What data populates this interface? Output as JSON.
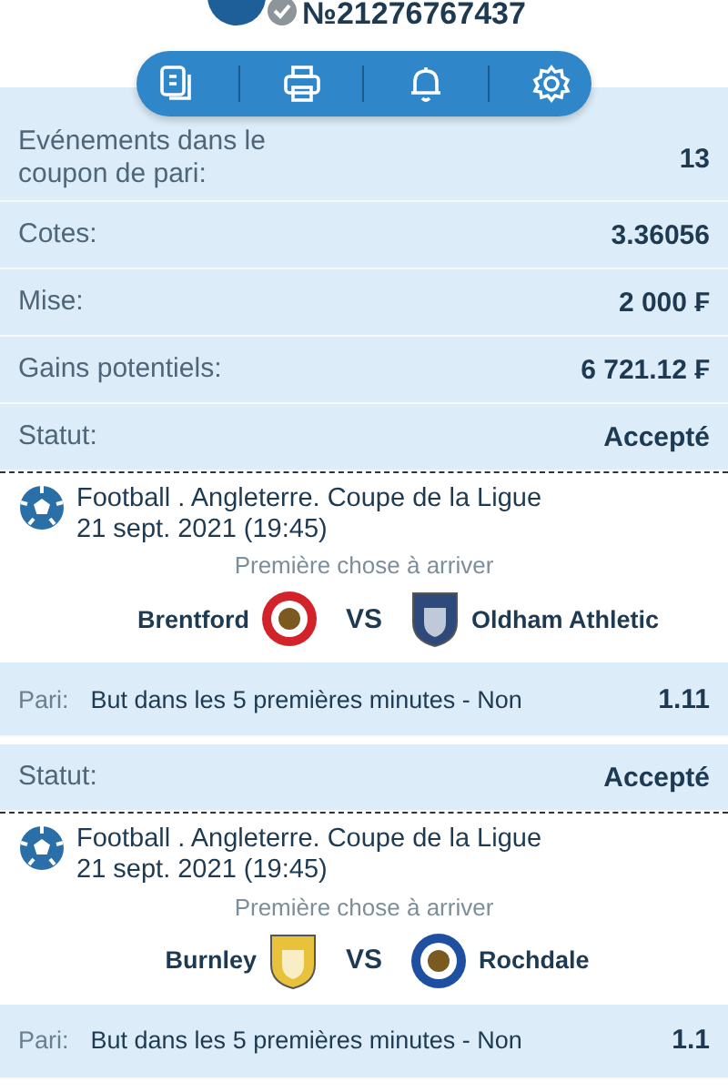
{
  "header": {
    "title": "№21276767437"
  },
  "summary": [
    {
      "label": "Evénements dans le coupon de pari:",
      "value": "13"
    },
    {
      "label": "Cotes:",
      "value": "3.36056"
    },
    {
      "label": "Mise:",
      "value": "2 000 ₣"
    },
    {
      "label": "Gains potentiels:",
      "value": "6 721.12 ₣"
    },
    {
      "label": "Statut:",
      "value": "Accepté"
    }
  ],
  "events": [
    {
      "league": "Football . Angleterre. Coupe de la Ligue",
      "date": "21 sept. 2021 (19:45)",
      "market": "Première chose à arriver",
      "home": {
        "name": "Brentford",
        "crest": {
          "kind": "round",
          "color": "#d2232a"
        }
      },
      "vs": "VS",
      "away": {
        "name": "Oldham Athletic",
        "crest": {
          "kind": "shield",
          "color": "#2e4a7a"
        }
      },
      "bet_label": "Pari:",
      "bet": "But dans les 5 premières minutes - Non",
      "odds": "1.11"
    },
    {
      "status": {
        "label": "Statut:",
        "value": "Accepté"
      },
      "league": "Football . Angleterre. Coupe de la Ligue",
      "date": "21 sept. 2021 (19:45)",
      "market": "Première chose à arriver",
      "home": {
        "name": "Burnley",
        "crest": {
          "kind": "shield",
          "color": "#e8c23a"
        }
      },
      "vs": "VS",
      "away": {
        "name": "Rochdale",
        "crest": {
          "kind": "round",
          "color": "#1f4fa0"
        }
      },
      "bet_label": "Pari:",
      "bet": "But dans les 5 premières minutes - Non",
      "odds": "1.1"
    }
  ]
}
